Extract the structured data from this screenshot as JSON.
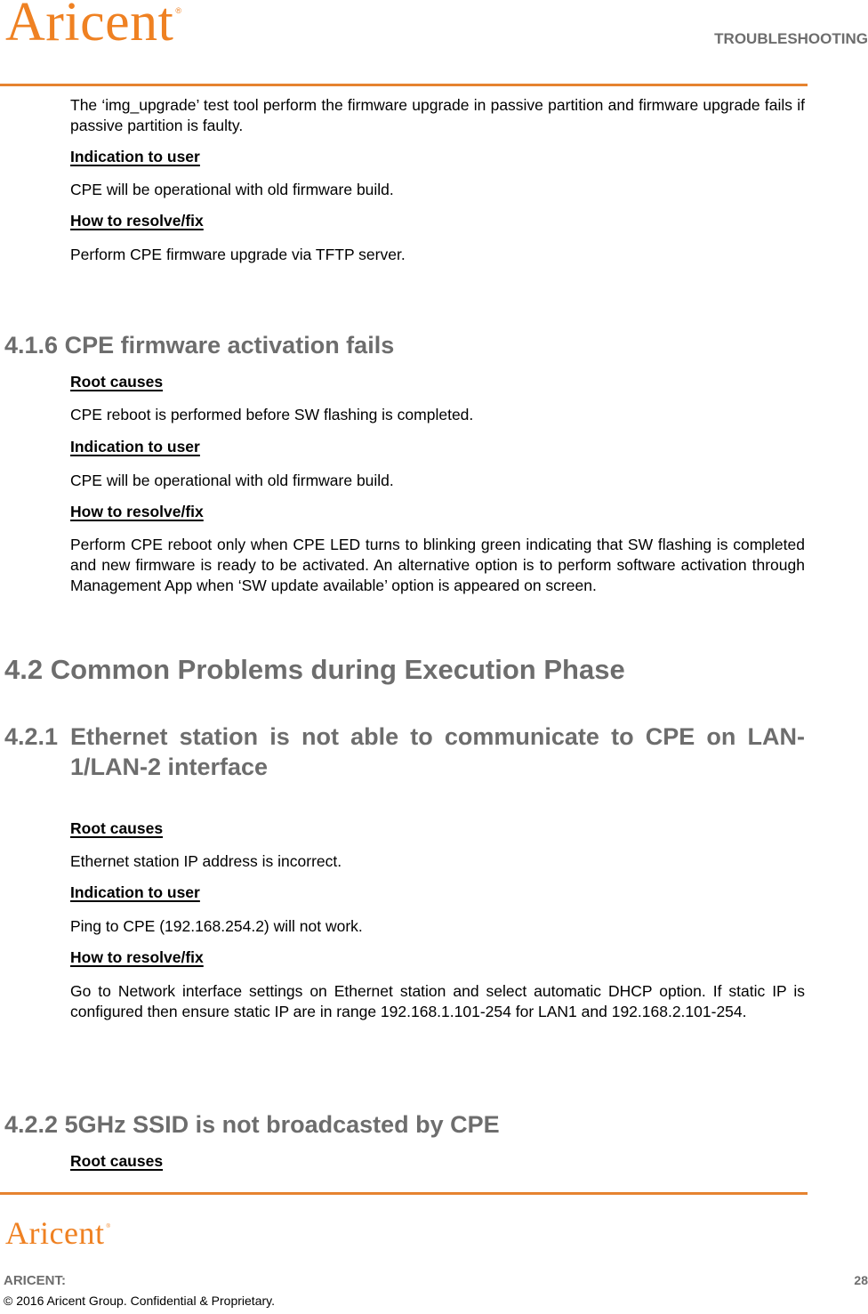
{
  "header": {
    "logo_text": "Aricent",
    "logo_mark": "®",
    "section": "TROUBLESHOOTING"
  },
  "colors": {
    "brand_orange": "#ef8122",
    "rule": "#e6832f",
    "heading_gray": "#6d6d6d"
  },
  "intro": {
    "paragraph": "The ‘img_upgrade’ test tool perform the firmware upgrade in passive partition and firmware upgrade fails if passive partition is faulty.",
    "indication_label": "Indication to user",
    "indication_text": "CPE will be operational with old firmware build.",
    "resolve_label": "How to resolve/fix",
    "resolve_text": "Perform CPE firmware upgrade via TFTP server."
  },
  "s416": {
    "number": "4.1.6",
    "title": "CPE firmware activation fails",
    "root_label": "Root causes",
    "root_text": "CPE reboot is performed before SW flashing is completed.",
    "indication_label": "Indication to user",
    "indication_text": "CPE will be operational with old firmware build.",
    "resolve_label": "How to resolve/fix",
    "resolve_text": "Perform CPE reboot only when CPE LED turns to blinking green indicating that SW flashing is completed and new firmware is ready to be activated. An alternative option is to perform software activation through Management App when ‘SW update available’ option is appeared on screen."
  },
  "s42": {
    "number": "4.2",
    "title": "Common Problems during Execution Phase"
  },
  "s421": {
    "number": "4.2.1",
    "title": "Ethernet station is not able to communicate to CPE on LAN-1/LAN-2 interface",
    "root_label": "Root causes",
    "root_text": "Ethernet station IP address is incorrect.",
    "indication_label": "Indication to user",
    "indication_text": "Ping to CPE (192.168.254.2) will not work.",
    "resolve_label": "How to resolve/fix",
    "resolve_text": "Go to Network interface settings on Ethernet station and select automatic DHCP option. If static IP is configured then ensure static IP are in range 192.168.1.101-254 for LAN1 and 192.168.2.101-254."
  },
  "s422": {
    "number": "4.2.2",
    "title": "5GHz SSID is not broadcasted by CPE",
    "root_label": "Root causes"
  },
  "footer": {
    "logo_text": "Aricent",
    "logo_mark": "®",
    "company": "ARICENT:",
    "copyright": "© 2016 Aricent Group. Confidential & Proprietary.",
    "page_number": "28"
  }
}
